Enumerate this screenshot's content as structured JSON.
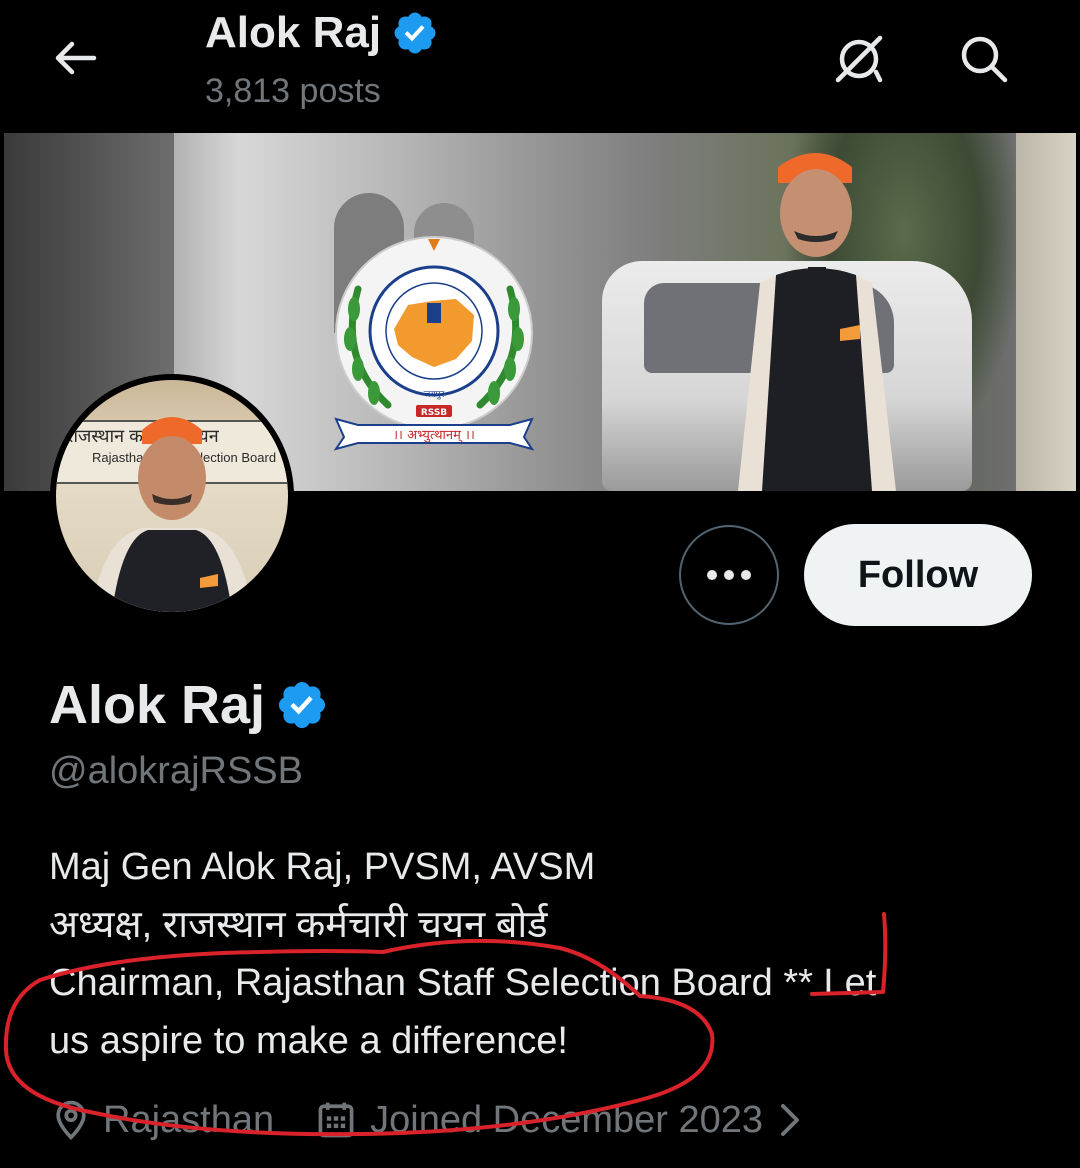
{
  "header": {
    "name": "Alok Raj",
    "posts": "3,813 posts"
  },
  "banner": {
    "logo_motto": "।। अभ्युत्थानम् ।।",
    "logo_abbr": "RSSB",
    "logo_city": "जयपुर",
    "logo_ring": "राजस्थान कर्मचारी चयन बोर्ड"
  },
  "avatar": {
    "board_line1": "राजस्थान कर्मचारी चयन",
    "board_line2": "Rajasthan Staff Selection Board"
  },
  "actions": {
    "follow_label": "Follow"
  },
  "profile": {
    "display_name": "Alok Raj",
    "handle": "@alokrajRSSB",
    "bio_lines": [
      "Maj Gen Alok Raj, PVSM, AVSM",
      "अध्यक्ष, राजस्थान कर्मचारी चयन बोर्ड",
      "Chairman, Rajasthan Staff Selection Board **  Let",
      "us aspire to make a difference!"
    ],
    "location": "Rajasthan",
    "joined": "Joined December 2023"
  },
  "colors": {
    "background": "#000000",
    "primary_text": "#e7e9ea",
    "secondary_text": "#71767b",
    "verified_blue": "#1d9bf0",
    "follow_bg": "#eff3f4",
    "annotation_red": "#d9222a"
  },
  "icons": [
    "back-arrow-icon",
    "grok-icon",
    "search-icon",
    "verified-badge-icon",
    "more-options-icon",
    "location-pin-icon",
    "calendar-icon",
    "chevron-right-icon"
  ]
}
